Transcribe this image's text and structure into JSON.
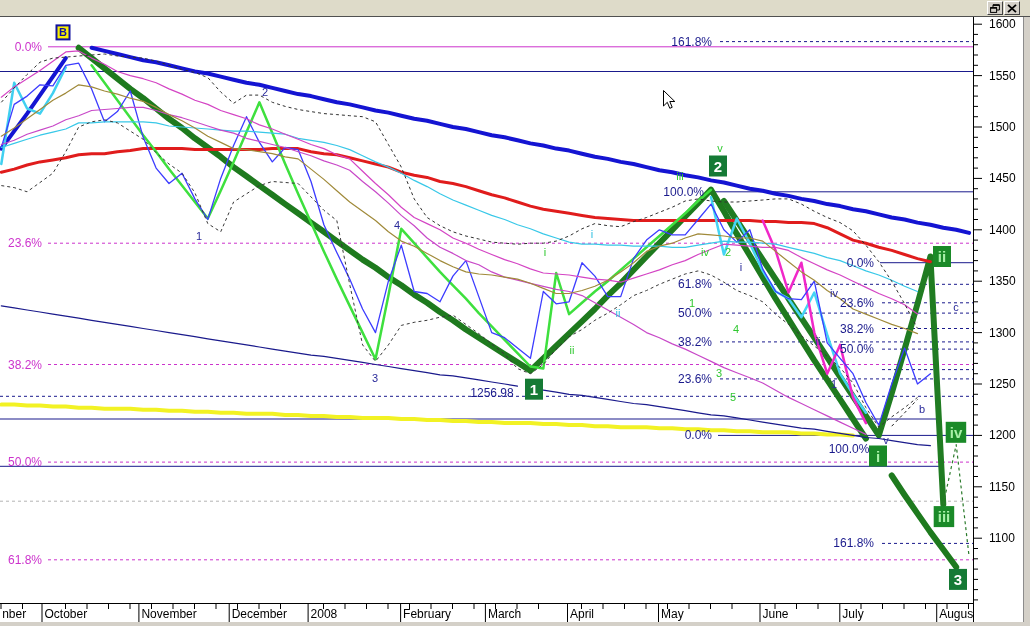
{
  "chart": {
    "chart_data": {
      "type": "line",
      "categories": [
        null,
        "nber",
        null,
        null,
        null,
        "October",
        null,
        null,
        null,
        null,
        null,
        null,
        null,
        "November",
        null,
        null,
        null,
        null,
        null,
        null,
        "December",
        null,
        null,
        null,
        null,
        "2008",
        null,
        null,
        null,
        null,
        null,
        null,
        null,
        "February",
        null,
        null,
        null,
        null,
        null,
        "March",
        null,
        null,
        null,
        null,
        null,
        "April",
        null,
        null,
        null,
        null,
        null,
        null,
        "May",
        null,
        null,
        null,
        null,
        null,
        null,
        null,
        "June",
        null,
        null,
        null,
        null,
        null,
        "July",
        null,
        null,
        null,
        null,
        null,
        null,
        null,
        "Augus",
        null
      ],
      "ylim": [
        1037,
        1606
      ],
      "yticks": [
        1100,
        1150,
        1200,
        1250,
        1300,
        1350,
        1400,
        1450,
        1500,
        1550,
        1600
      ],
      "series": [
        {
          "color": "#3c3cff",
          "values": [
            1480,
            1522,
            1530,
            1541,
            1540,
            1560,
            1562,
            1537,
            1505,
            1515,
            1535,
            1490,
            1460,
            1445,
            1455,
            1430,
            1410,
            1450,
            1482,
            1510,
            1485,
            1466,
            1480,
            1478,
            1447,
            1405,
            1378,
            1352,
            1323,
            1300,
            1350,
            1385,
            1340,
            1338,
            1330,
            1355,
            1370,
            1335,
            1300,
            1295,
            1285,
            1275,
            1340,
            1328,
            1330,
            1368,
            1355,
            1335,
            1335,
            1372,
            1390,
            1400,
            1395,
            1395,
            1410,
            1425,
            1400,
            1388,
            1400,
            1362,
            1340,
            1333,
            1332,
            1350,
            1290,
            1275,
            1260,
            1232,
            1210,
            1250,
            1285,
            1250,
            1260,
            null,
            null,
            null
          ]
        },
        {
          "color": "#e01c1c",
          "values": [
            1456,
            1459,
            1463,
            1466,
            1468,
            1470,
            1473,
            1474,
            1474,
            1476,
            1477,
            1479,
            1479,
            1479,
            1479,
            1478,
            1478,
            1478,
            1478,
            1478,
            1478,
            1479,
            1479,
            1479,
            1476,
            1474,
            1473,
            1470,
            1467,
            1464,
            1461,
            1456,
            1453,
            1451,
            1447,
            1445,
            1442,
            1438,
            1434,
            1431,
            1427,
            1423,
            1420,
            1418,
            1416,
            1414,
            1412,
            1411,
            1410,
            1409,
            1409,
            1409,
            1409,
            1409,
            1409,
            1409,
            1409,
            1409,
            1409,
            1408,
            1408,
            1407,
            1407,
            1406,
            1402,
            1396,
            1390,
            1387,
            1383,
            1380,
            1376,
            1372,
            1369,
            null,
            null,
            null
          ]
        },
        {
          "color": "#38c8e8",
          "values": [
            1480,
            1484,
            1488,
            1492,
            1495,
            1498,
            1504,
            1504,
            1505,
            1505,
            1505,
            1505,
            1504,
            1501,
            1500,
            1499,
            1498,
            1497,
            1496,
            1496,
            1495,
            1494,
            1493,
            1489,
            1487,
            1485,
            1482,
            1478,
            1472,
            1466,
            1461,
            1455,
            1448,
            1442,
            1435,
            1429,
            1424,
            1419,
            1414,
            1410,
            1405,
            1401,
            1396,
            1392,
            1388,
            1386,
            1386,
            1385,
            1385,
            1384,
            1384,
            1384,
            1383,
            1383,
            1385,
            1387,
            1389,
            1388,
            1388,
            1387,
            1386,
            1383,
            1380,
            1377,
            1373,
            1370,
            1365,
            1360,
            1356,
            1351,
            1345,
            1340,
            null,
            null,
            null,
            null
          ]
        },
        {
          "color": "#d444c4",
          "values": [
            1529,
            1539,
            1547,
            1555,
            1564,
            1573,
            1574,
            1567,
            1561,
            1554,
            1550,
            1547,
            1543,
            1537,
            1532,
            1526,
            1522,
            1516,
            1512,
            1508,
            1502,
            1498,
            1493,
            1488,
            1483,
            1479,
            1473,
            1469,
            1457,
            1445,
            1434,
            1422,
            1412,
            1406,
            1400,
            1392,
            1387,
            1381,
            1376,
            1371,
            1367,
            1362,
            1358,
            1357,
            1356,
            1354,
            1352,
            1351,
            1349,
            1353,
            1357,
            1361,
            1366,
            1370,
            1376,
            1381,
            1386,
            1385,
            1384,
            1383,
            1383,
            1380,
            1373,
            1367,
            1361,
            1356,
            1350,
            1344,
            1338,
            1333,
            1327,
            1318,
            null,
            null,
            null,
            null
          ]
        },
        {
          "color": "#c848c8",
          "values": [
            1483,
            1487,
            1493,
            1497,
            1501,
            1507,
            1511,
            1516,
            1517,
            1518,
            1519,
            1519,
            1516,
            1512,
            1509,
            1505,
            1501,
            1497,
            1494,
            1489,
            1486,
            1483,
            1480,
            1476,
            1472,
            1467,
            1463,
            1458,
            1447,
            1437,
            1426,
            1414,
            1404,
            1392,
            1383,
            1377,
            1370,
            1366,
            1359,
            1354,
            1351,
            1348,
            1345,
            1342,
            1340,
            1336,
            1329,
            1322,
            1315,
            1308,
            1300,
            1295,
            1289,
            1284,
            1278,
            1272,
            1266,
            1261,
            1256,
            1251,
            1244,
            1237,
            1231,
            1225,
            1219,
            1213,
            1207,
            1201,
            null,
            null,
            null,
            null,
            null,
            null,
            null,
            null
          ]
        },
        {
          "color": "#a08a3a",
          "values": [
            1491,
            1499,
            1508,
            1517,
            1526,
            1533,
            1541,
            1539,
            1535,
            1532,
            1528,
            1525,
            1519,
            1512,
            1506,
            1499,
            1491,
            1485,
            1479,
            1478,
            1476,
            1474,
            1471,
            1469,
            1459,
            1449,
            1438,
            1427,
            1418,
            1409,
            1398,
            1389,
            1384,
            1377,
            1370,
            1364,
            1359,
            1357,
            1356,
            1354,
            1352,
            1348,
            1343,
            1338,
            1338,
            1341,
            1345,
            1351,
            1359,
            1368,
            1379,
            1384,
            1387,
            1392,
            1396,
            1395,
            1394,
            1392,
            1392,
            1389,
            1379,
            1369,
            1359,
            1351,
            1341,
            1333,
            1323,
            1318,
            1313,
            1308,
            1304,
            1299,
            null,
            null,
            null,
            null
          ]
        },
        {
          "color": "#303030",
          "line_style": "dashed",
          "values": [
            1524,
            1538,
            1551,
            1563,
            1567,
            1568,
            1569,
            1570,
            1571,
            1569,
            1568,
            1567,
            1564,
            1560,
            1556,
            1553,
            1548,
            1534,
            1523,
            1531,
            1531,
            1524,
            1520,
            1517,
            1515,
            1513,
            1512,
            1511,
            1510,
            1505,
            1483,
            1461,
            1430,
            1412,
            1404,
            1398,
            1394,
            1391,
            1388,
            1387,
            1386,
            1387,
            1387,
            1389,
            1394,
            1401,
            1406,
            1404,
            1403,
            1408,
            1412,
            1417,
            1422,
            1428,
            1430,
            1428,
            1427,
            1427,
            1428,
            1429,
            1430,
            1430,
            1425,
            1418,
            1412,
            1407,
            1399,
            1385,
            1369,
            1350,
            1328,
            1304,
            null,
            null,
            null,
            null
          ]
        },
        {
          "color": "#383838",
          "line_style": "dashed",
          "values": [
            1443,
            1441,
            1437,
            1446,
            1455,
            1476,
            1500,
            1505,
            1507,
            1504,
            1496,
            1488,
            1475,
            1464,
            1455,
            1436,
            1406,
            1398,
            1427,
            1435,
            1443,
            1447,
            1446,
            1445,
            1432,
            1419,
            1409,
            1347,
            1288,
            1272,
            1288,
            1307,
            1310,
            1312,
            1315,
            1317,
            1308,
            1299,
            1289,
            1279,
            1265,
            1260,
            1269,
            1284,
            1296,
            1303,
            1312,
            1319,
            1327,
            1336,
            1341,
            1347,
            1352,
            1357,
            1360,
            1356,
            1349,
            1341,
            1336,
            1330,
            1318,
            1308,
            1297,
            1287,
            1277,
            1266,
            1251,
            1227,
            1208,
            1218,
            1227,
            1237,
            null,
            null,
            null,
            null
          ]
        },
        {
          "color": "#1414d2",
          "values": [
            1479,
            1496,
            1513,
            1531,
            1549,
            1567,
            null,
            1577,
            1574,
            1571,
            1568,
            1565,
            1563,
            1560,
            1557,
            1554,
            1552,
            1549,
            1546,
            1543,
            1541,
            1538,
            1535,
            1532,
            1530,
            1527,
            1524,
            1522,
            1519,
            1516,
            1514,
            1511,
            1508,
            1506,
            1503,
            1500,
            1498,
            1495,
            1492,
            1490,
            1487,
            1484,
            1482,
            1479,
            1477,
            1474,
            1471,
            1469,
            1466,
            1464,
            1461,
            1458,
            1456,
            1453,
            1451,
            1448,
            1446,
            1443,
            1440,
            1438,
            1435,
            1433,
            1430,
            1428,
            1425,
            1423,
            1420,
            1418,
            1415,
            1412,
            1410,
            1407,
            1405,
            1402,
            1400,
            1397
          ]
        },
        {
          "color": "#f2f224",
          "values": [
            1230,
            1230,
            1229,
            1229,
            1228,
            1228,
            1227,
            1227,
            1226,
            1226,
            1226,
            1225,
            1225,
            1224,
            1224,
            1223,
            1223,
            1222,
            1222,
            1221,
            1221,
            1221,
            1220,
            1220,
            1219,
            1219,
            1218,
            1218,
            1217,
            1217,
            1217,
            1216,
            1216,
            1215,
            1215,
            1214,
            1214,
            1213,
            1213,
            1212,
            1212,
            1212,
            1211,
            1211,
            1210,
            1210,
            1209,
            1209,
            1208,
            1208,
            1208,
            1207,
            1207,
            1206,
            1206,
            1205,
            1205,
            1204,
            1204,
            1203,
            1203,
            1203,
            1202,
            1202,
            1201,
            1201,
            1200,
            null,
            null,
            null,
            null,
            null,
            null,
            null,
            null,
            null
          ]
        },
        {
          "color": "#1a1a8c",
          "values": [
            1326,
            1324,
            1322,
            1320,
            1318,
            1316,
            1314,
            1312,
            1310,
            1308,
            1306,
            1304,
            1302,
            1300,
            1298,
            1296,
            1294,
            1292,
            1290,
            1288,
            1286,
            1284,
            1282,
            1280,
            1278,
            1277,
            1275,
            1273,
            1271,
            1269,
            1267,
            1265,
            1263,
            1261,
            1259,
            1258,
            1256,
            1254,
            1252,
            1250,
            1248,
            null,
            1244,
            1242,
            1240,
            1239,
            1237,
            1235,
            1233,
            1231,
            1230,
            1228,
            1226,
            1224,
            1222,
            1220,
            1219,
            1217,
            1215,
            1213,
            1211,
            1209,
            1207,
            1206,
            1204,
            1202,
            1200,
            1198,
            1197,
            1195,
            1193,
            1191,
            1190,
            null,
            null,
            null
          ]
        },
        {
          "color": "#1e7a1e",
          "values": [
            null,
            null,
            null,
            null,
            null,
            null,
            1577,
            1567,
            1557,
            1547,
            1537,
            1528,
            1518,
            1508,
            1499,
            1489,
            1480,
            1471,
            1461,
            1452,
            1443,
            1434,
            1425,
            1416,
            1407,
            1398,
            1389,
            1380,
            1371,
            1363,
            1354,
            1346,
            1337,
            1329,
            1320,
            1312,
            1303,
            1295,
            1287,
            1279,
            1271,
            1263,
            1275,
            1287,
            1299,
            1311,
            1323,
            1336,
            1348,
            1361,
            1374,
            1387,
            1400,
            1413,
            1426,
            1439,
            1418,
            1396,
            1375,
            1354,
            1333,
            1313,
            1293,
            1273,
            1254,
            1235,
            1216,
            1197,
            null,
            1161,
            1142,
            1124,
            1106,
            1089,
            1072,
            null
          ]
        },
        {
          "color": "#207c22",
          "values": [
            null,
            null,
            null,
            null,
            null,
            null,
            null,
            null,
            null,
            null,
            null,
            null,
            null,
            null,
            null,
            null,
            null,
            null,
            null,
            null,
            null,
            null,
            null,
            null,
            null,
            null,
            null,
            null,
            null,
            null,
            null,
            null,
            null,
            null,
            null,
            null,
            null,
            null,
            null,
            null,
            null,
            null,
            null,
            null,
            null,
            null,
            null,
            null,
            null,
            null,
            null,
            null,
            null,
            null,
            null,
            null,
            1428,
            1409,
            1390,
            1371,
            1352,
            1333,
            1314,
            1295,
            1276,
            1257,
            1238,
            1219,
            1200,
            1241,
            1284,
            1328,
            1374,
            1133,
            null,
            null
          ]
        },
        {
          "color": "#2a7a2a",
          "line_style": "dashed",
          "values": [
            null,
            null,
            null,
            null,
            null,
            null,
            null,
            null,
            null,
            null,
            null,
            null,
            null,
            null,
            null,
            null,
            null,
            null,
            null,
            null,
            null,
            null,
            null,
            null,
            null,
            null,
            null,
            null,
            null,
            null,
            null,
            null,
            null,
            null,
            null,
            null,
            null,
            null,
            null,
            null,
            null,
            null,
            null,
            null,
            null,
            null,
            null,
            null,
            null,
            null,
            null,
            null,
            null,
            null,
            null,
            null,
            null,
            null,
            null,
            null,
            null,
            null,
            null,
            null,
            null,
            null,
            null,
            null,
            null,
            null,
            null,
            null,
            null,
            1133,
            1191,
            1082
          ]
        },
        {
          "color": "#3ee03e",
          "values": [
            null,
            null,
            null,
            null,
            null,
            null,
            null,
            1560,
            1543,
            1526,
            1509,
            1492,
            1476,
            1459,
            1443,
            1427,
            1411,
            1438,
            1466,
            1495,
            1524,
            1494,
            1464,
            1435,
            1407,
            1379,
            1352,
            1326,
            1300,
            1274,
            1336,
            1401,
            1387,
            1373,
            1359,
            1346,
            1333,
            1319,
            1306,
            1293,
            1280,
            1267,
            1265,
            1358,
            1318,
            1329,
            1340,
            1350,
            1361,
            1372,
            1383,
            1394,
            1405,
            1416,
            1428,
            1439,
            null,
            null,
            null,
            null,
            null,
            null,
            null,
            null,
            null,
            null,
            null,
            null,
            null,
            null,
            null,
            null,
            null,
            null,
            null,
            null
          ]
        },
        {
          "color": "#40d0f0",
          "values": [
            1464,
            1543,
            1518,
            1513,
            1533,
            1558,
            null,
            null,
            null,
            null,
            null,
            null,
            null,
            null,
            null,
            null,
            null,
            null,
            null,
            null,
            null,
            null,
            null,
            null,
            null,
            null,
            null,
            null,
            null,
            null,
            null,
            null,
            null,
            null,
            null,
            null,
            null,
            null,
            null,
            null,
            null,
            null,
            null,
            null,
            null,
            null,
            null,
            null,
            null,
            null,
            null,
            null,
            null,
            null,
            null,
            null,
            null,
            null,
            null,
            null,
            null,
            null,
            null,
            null,
            null,
            null,
            null,
            null,
            null,
            null,
            null,
            null,
            null,
            null,
            null,
            null
          ]
        },
        {
          "color": "#44d4f4",
          "values": [
            null,
            null,
            null,
            null,
            null,
            null,
            null,
            null,
            null,
            null,
            null,
            null,
            null,
            null,
            null,
            null,
            null,
            null,
            null,
            null,
            null,
            null,
            null,
            null,
            null,
            null,
            null,
            null,
            null,
            null,
            null,
            null,
            null,
            null,
            null,
            null,
            null,
            null,
            null,
            null,
            null,
            null,
            null,
            null,
            null,
            null,
            null,
            null,
            null,
            null,
            null,
            null,
            null,
            null,
            null,
            1432,
            1376,
            1411,
            1387,
            1360,
            1340,
            1333,
            1315,
            1339,
            1298,
            1260,
            1240,
            1222,
            null,
            null,
            null,
            null,
            null,
            null,
            null,
            null
          ]
        },
        {
          "color": "#f028c8",
          "values": [
            null,
            null,
            null,
            null,
            null,
            null,
            null,
            null,
            null,
            null,
            null,
            null,
            null,
            null,
            null,
            null,
            null,
            null,
            null,
            null,
            null,
            null,
            null,
            null,
            null,
            null,
            null,
            null,
            null,
            null,
            null,
            null,
            null,
            null,
            null,
            null,
            null,
            null,
            null,
            null,
            null,
            null,
            null,
            null,
            null,
            null,
            null,
            null,
            null,
            null,
            null,
            null,
            null,
            null,
            null,
            null,
            null,
            null,
            null,
            1409,
            1380,
            1339,
            1368,
            1300,
            1260,
            1288,
            1237,
            1212,
            null,
            null,
            null,
            null,
            null,
            null,
            null,
            null
          ]
        },
        {
          "color": "#202020",
          "line_style": "dashed",
          "values": [
            null,
            null,
            null,
            null,
            null,
            null,
            null,
            null,
            null,
            null,
            null,
            null,
            null,
            null,
            null,
            null,
            null,
            null,
            null,
            null,
            null,
            null,
            null,
            null,
            null,
            null,
            null,
            null,
            null,
            null,
            null,
            null,
            null,
            null,
            null,
            null,
            null,
            null,
            null,
            null,
            null,
            null,
            null,
            null,
            null,
            null,
            null,
            null,
            null,
            null,
            null,
            null,
            null,
            null,
            null,
            null,
            null,
            null,
            null,
            null,
            null,
            null,
            null,
            null,
            null,
            null,
            null,
            null,
            null,
            1209,
            1222,
            1235,
            null,
            null,
            null,
            null
          ]
        }
      ],
      "ref_lines": [
        {
          "axis": "y",
          "value": 1578,
          "color": "#cc33cc"
        },
        {
          "axis": "y",
          "value": 1387,
          "color": "#cc33cc"
        },
        {
          "axis": "y",
          "value": 1269,
          "color": "#cc33cc"
        },
        {
          "axis": "y",
          "value": 1174,
          "color": "#cc33cc"
        },
        {
          "axis": "y",
          "value": 1079,
          "color": "#cc33cc"
        },
        {
          "axis": "y",
          "value": 1554,
          "color": "#1a1a8c"
        },
        {
          "axis": "y",
          "value": 1216,
          "color": "#1a1a8c"
        },
        {
          "axis": "y",
          "value": 1170,
          "color": "#1a1a8c"
        },
        {
          "axis": "y",
          "value": 1136,
          "color": "#b4b4b4"
        },
        {
          "axis": "y",
          "value": 1238,
          "color": "#1a1a8c"
        },
        {
          "axis": "y",
          "value": 1583,
          "color": "#1a1a8c"
        },
        {
          "axis": "y",
          "value": 1437,
          "color": "#1a1a8c"
        },
        {
          "axis": "y",
          "value": 1347,
          "color": "#1a1a8c"
        },
        {
          "axis": "y",
          "value": 1319,
          "color": "#1a1a8c"
        },
        {
          "axis": "y",
          "value": 1291,
          "color": "#1a1a8c"
        },
        {
          "axis": "y",
          "value": 1255,
          "color": "#1a1a8c"
        },
        {
          "axis": "y",
          "value": 1200,
          "color": "#1a1a8c"
        },
        {
          "axis": "y",
          "value": 1368,
          "color": "#1a1a8c"
        },
        {
          "axis": "y",
          "value": 1329,
          "color": "#1a1a8c"
        },
        {
          "axis": "y",
          "value": 1304,
          "color": "#1a1a8c"
        },
        {
          "axis": "y",
          "value": 1284,
          "color": "#1a1a8c"
        },
        {
          "axis": "y",
          "value": 1264,
          "color": "#1a1a8c"
        },
        {
          "axis": "y",
          "value": 1095,
          "color": "#1a1a8c"
        }
      ],
      "annotations": [
        "0.0%",
        "23.6%",
        "38.2%",
        "50.0%",
        "61.8%",
        "161.8%",
        "100.0%",
        "61.8%",
        "50.0%",
        "38.2%",
        "23.6%",
        "0.0%",
        "0.0%",
        "23.6%",
        "38.2%",
        "50.0%",
        "161.8%",
        "1256.98",
        "100.0%"
      ]
    },
    "wave_labels": [
      {
        "text": "1",
        "kind": "primary"
      },
      {
        "text": "2",
        "kind": "primary"
      },
      {
        "text": "3",
        "kind": "primary"
      },
      {
        "text": "4",
        "kind": "primary"
      },
      {
        "text": "i",
        "kind": "primary"
      },
      {
        "text": "iv",
        "kind": "primary"
      },
      {
        "text": "ii",
        "kind": "primary"
      },
      {
        "text": "1",
        "kind": "primary"
      },
      {
        "text": "v",
        "kind": "primary"
      },
      {
        "text": "b",
        "kind": "primary"
      },
      {
        "text": "c",
        "kind": "primary"
      },
      {
        "text": "v",
        "kind": "minor"
      },
      {
        "text": "i",
        "kind": "minor"
      },
      {
        "text": "ii",
        "kind": "minor"
      },
      {
        "text": "iii",
        "kind": "minor"
      },
      {
        "text": "iv",
        "kind": "minor"
      },
      {
        "text": "1",
        "kind": "minor"
      },
      {
        "text": "2",
        "kind": "minor"
      },
      {
        "text": "3",
        "kind": "minor"
      },
      {
        "text": "4",
        "kind": "minor"
      },
      {
        "text": "5",
        "kind": "minor"
      },
      {
        "text": "i",
        "kind": "subminor"
      },
      {
        "text": "ii",
        "kind": "subminor"
      }
    ],
    "wave_markers": [
      {
        "text": "B",
        "kind": "outlined",
        "color": "#f8f000"
      },
      {
        "text": "1",
        "kind": "major",
        "color": "#157a35"
      },
      {
        "text": "2",
        "kind": "major",
        "color": "#157a35"
      },
      {
        "text": "i",
        "kind": "minor",
        "color": "#1a8a28"
      },
      {
        "text": "ii",
        "kind": "minor",
        "color": "#1a8a28"
      },
      {
        "text": "iii",
        "kind": "minor",
        "color": "#1a8a28"
      },
      {
        "text": "iv",
        "kind": "minor",
        "color": "#1a8a28"
      },
      {
        "text": "3",
        "kind": "major",
        "color": "#157a35"
      }
    ]
  }
}
